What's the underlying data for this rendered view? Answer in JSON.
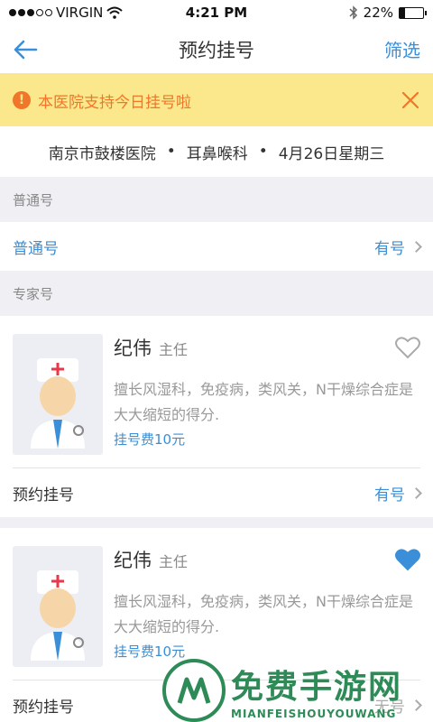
{
  "status_bar": {
    "carrier": "VIRGIN",
    "time": "4:21 PM",
    "battery": "22%",
    "battery_level": 0.22
  },
  "nav": {
    "title": "预约挂号",
    "filter_label": "筛选"
  },
  "notice": {
    "text": "本医院支持今日挂号啦"
  },
  "hospital": {
    "name": "南京市鼓楼医院",
    "department": "耳鼻喉科",
    "date": "4月26日星期三",
    "separator": "•"
  },
  "general": {
    "section_label": "普通号",
    "row_label": "普通号",
    "availability": "有号"
  },
  "expert": {
    "section_label": "专家号",
    "doctors": [
      {
        "name": "纪伟",
        "title": "主任",
        "desc": "擅长风湿科，免疫病，类风关，N干燥综合症是大大缩短的得分.",
        "fee": "挂号费10元",
        "favorited": false,
        "action_label": "预约挂号",
        "availability": "有号"
      },
      {
        "name": "纪伟",
        "title": "主任",
        "desc": "擅长风湿科，免疫病，类风关，N干燥综合症是大大缩短的得分.",
        "fee": "挂号费10元",
        "favorited": true,
        "action_label": "预约挂号",
        "availability": "无号"
      }
    ]
  },
  "watermark": {
    "title": "免费手游网",
    "subtitle": "MIANFEISHOUYOUWANG"
  },
  "colors": {
    "accent": "#3a8fd8",
    "notice_bg": "#fce88c",
    "notice_text": "#f0762a",
    "watermark": "#2e8b57"
  }
}
